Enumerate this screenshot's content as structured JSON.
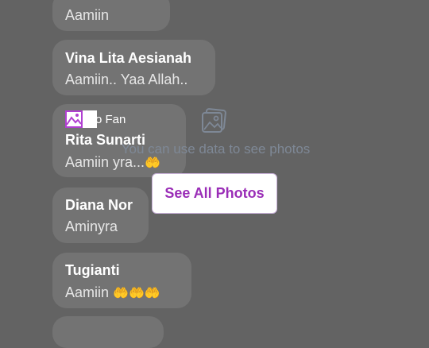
{
  "comments": [
    {
      "name": "",
      "text": "Aamiin"
    },
    {
      "name": "Vina Lita Aesianah",
      "text": "Aamiin.. Yaa Allah.."
    },
    {
      "name": "Rita Sunarti",
      "text": "Aamiin yra...",
      "emoji": "🤲"
    },
    {
      "name": "Diana Nor",
      "text": "Aminyra"
    },
    {
      "name": "Tugianti",
      "text": "Aamiin ",
      "emoji": "🤲🤲🤲"
    }
  ],
  "fan_badge": {
    "label": "o Fan"
  },
  "photo_placeholder": {
    "message": "You can use data to see photos",
    "icon": "image-icon"
  },
  "see_all_button": {
    "label": "See All Photos"
  },
  "colors": {
    "background": "#636363",
    "bubble": "#737373",
    "accent": "#9a2db7"
  }
}
